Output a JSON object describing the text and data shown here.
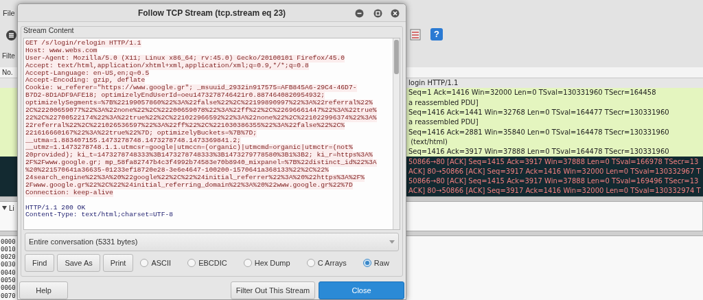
{
  "main_window": {
    "menu": [
      {
        "label": "File"
      }
    ],
    "toolbar_help": "?",
    "filter_label": "Filte",
    "packet_list": {
      "column_1_header": "No.",
      "rows": [
        {
          "kind": "plain",
          "text": "login HTTP/1.1"
        },
        {
          "kind": "green",
          "text": "Seq=1 Ack=1416 Win=32000 Len=0 TSval=130331960 TSecr=164458"
        },
        {
          "kind": "green",
          "text": "a reassembled PDU]"
        },
        {
          "kind": "green",
          "text": "Seq=1416 Ack=1441 Win=32768 Len=0 TSval=164477 TSecr=130331960"
        },
        {
          "kind": "green",
          "text": "a reassembled PDU]"
        },
        {
          "kind": "green",
          "text": "Seq=1416 Ack=2881 Win=35840 Len=0 TSval=164478 TSecr=130331960"
        },
        {
          "kind": "green",
          "text": " (text/html)"
        },
        {
          "kind": "green",
          "text": "Seq=1416 Ack=3917 Win=37888 Len=0 TSval=164478 TSecr=130331960"
        },
        {
          "kind": "dark",
          "text": "50866→80 [ACK] Seq=1415 Ack=3917 Win=37888 Len=0 TSval=166978 TSecr=13"
        },
        {
          "kind": "dark",
          "text": "ACK] 80→50866 [ACK] Seq=3917 Ack=1416 Win=32000 Len=0 TSval=130332967 T"
        },
        {
          "kind": "dark",
          "text": "50866→80 [ACK] Seq=1415 Ack=3917 Win=37888 Len=0 TSval=169496 TSecr=13"
        },
        {
          "kind": "dark",
          "text": "ACK] 80→50866 [ACK] Seq=3917 Ack=1416 Win=32000 Len=0 TSval=130332974 T"
        }
      ]
    },
    "details": {
      "items": [
        {
          "label": "Li"
        }
      ]
    },
    "hex_offsets": [
      "0000",
      "0010",
      "0020",
      "0030",
      "0040",
      "0050",
      "0060",
      "0070"
    ]
  },
  "dialog": {
    "title": "Follow TCP Stream (tcp.stream eq 23)",
    "stream_label": "Stream Content",
    "lines": [
      {
        "kind": "client",
        "text": "GET /s/login/relogin HTTP/1.1"
      },
      {
        "kind": "client",
        "text": "Host: www.webs.com"
      },
      {
        "kind": "client",
        "text": "User-Agent: Mozilla/5.0 (X11; Linux x86_64; rv:45.0) Gecko/20100101 Firefox/45.0"
      },
      {
        "kind": "client",
        "text": "Accept: text/html,application/xhtml+xml,application/xml;q=0.9,*/*;q=0.8"
      },
      {
        "kind": "client",
        "text": "Accept-Language: en-US,en;q=0.5"
      },
      {
        "kind": "client",
        "text": "Accept-Encoding: gzip, deflate"
      },
      {
        "kind": "client",
        "text": "Cookie: w_referer=\"https://www.google.gr\"; _msuuid_2932in917575=AFB845A6-29C4-46D7-"
      },
      {
        "kind": "client",
        "text": "B7D2-8D1ADF9AFE18; optimizelyEndUserId=oeu1473278746421r0.8874640820954932;"
      },
      {
        "kind": "client",
        "text": "optimizelySegments=%7B%22199057860%22%3A%22false%22%2C%22199890997%22%3A%22referral%22%"
      },
      {
        "kind": "client",
        "text": "2C%22200659077%22%3A%22none%22%2C%22200659078%22%3A%22ff%22%2C%22696661447%22%3A%22true%"
      },
      {
        "kind": "client",
        "text": "22%2C%22700522174%22%3A%22true%22%2C%221022966592%22%3A%22none%22%2C%221022996374%22%3A%"
      },
      {
        "kind": "client",
        "text": "22referral%22%2C%221026536597%22%3A%22ff%22%2C%221030386355%22%3A%22false%22%2C%"
      },
      {
        "kind": "client",
        "text": "221616660167%22%3A%22true%22%7D; optimizelyBuckets=%7B%7D;"
      },
      {
        "kind": "client",
        "text": "__utma=1.883407155.1473278748.1473278748.1473369841.2;"
      },
      {
        "kind": "client",
        "text": "__utmz=1.1473278748.1.1.utmcsr=google|utmccn=(organic)|utmcmd=organic|utmctr=(not%"
      },
      {
        "kind": "client",
        "text": "20provided); ki_t=1473278748333%3B1473278748333%3B1473279778580%3B1%3B2; ki_r=https%3A%"
      },
      {
        "kind": "client",
        "text": "2F%2Fwww.google.gr; mp_58fa82747b4c3f4992b74583e70b8940_mixpanel=%7B%22distinct_id%22%3A"
      },
      {
        "kind": "client",
        "text": "%20%221570641a36635-01233ef18720e28-3e6e4647-100200-1570641a368133%22%2C%22%"
      },
      {
        "kind": "client",
        "text": "24search_engine%22%3A%20%22google%22%2C%22%24initial_referrer%22%3A%20%22https%3A%2F%"
      },
      {
        "kind": "client",
        "text": "2Fwww.google.gr%22%2C%22%24initial_referring_domain%22%3A%20%22www.google.gr%22%7D"
      },
      {
        "kind": "client",
        "text": "Connection: keep-alive"
      },
      {
        "kind": "blank"
      },
      {
        "kind": "server",
        "text": "HTTP/1.1 200 OK"
      },
      {
        "kind": "server",
        "text": "Content-Type: text/html;charset=UTF-8"
      }
    ],
    "conversation": "Entire conversation (5331 bytes)",
    "buttons": [
      "Find",
      "Save As",
      "Print"
    ],
    "formats": [
      {
        "label": "ASCII",
        "selected": false
      },
      {
        "label": "EBCDIC",
        "selected": false
      },
      {
        "label": "Hex Dump",
        "selected": false
      },
      {
        "label": "C Arrays",
        "selected": false
      },
      {
        "label": "Raw",
        "selected": true
      }
    ],
    "help_button": "Help",
    "footer_buttons": [
      {
        "kind": "secondary",
        "label": "Filter Out This Stream"
      },
      {
        "kind": "primary",
        "label": "Close"
      }
    ]
  }
}
